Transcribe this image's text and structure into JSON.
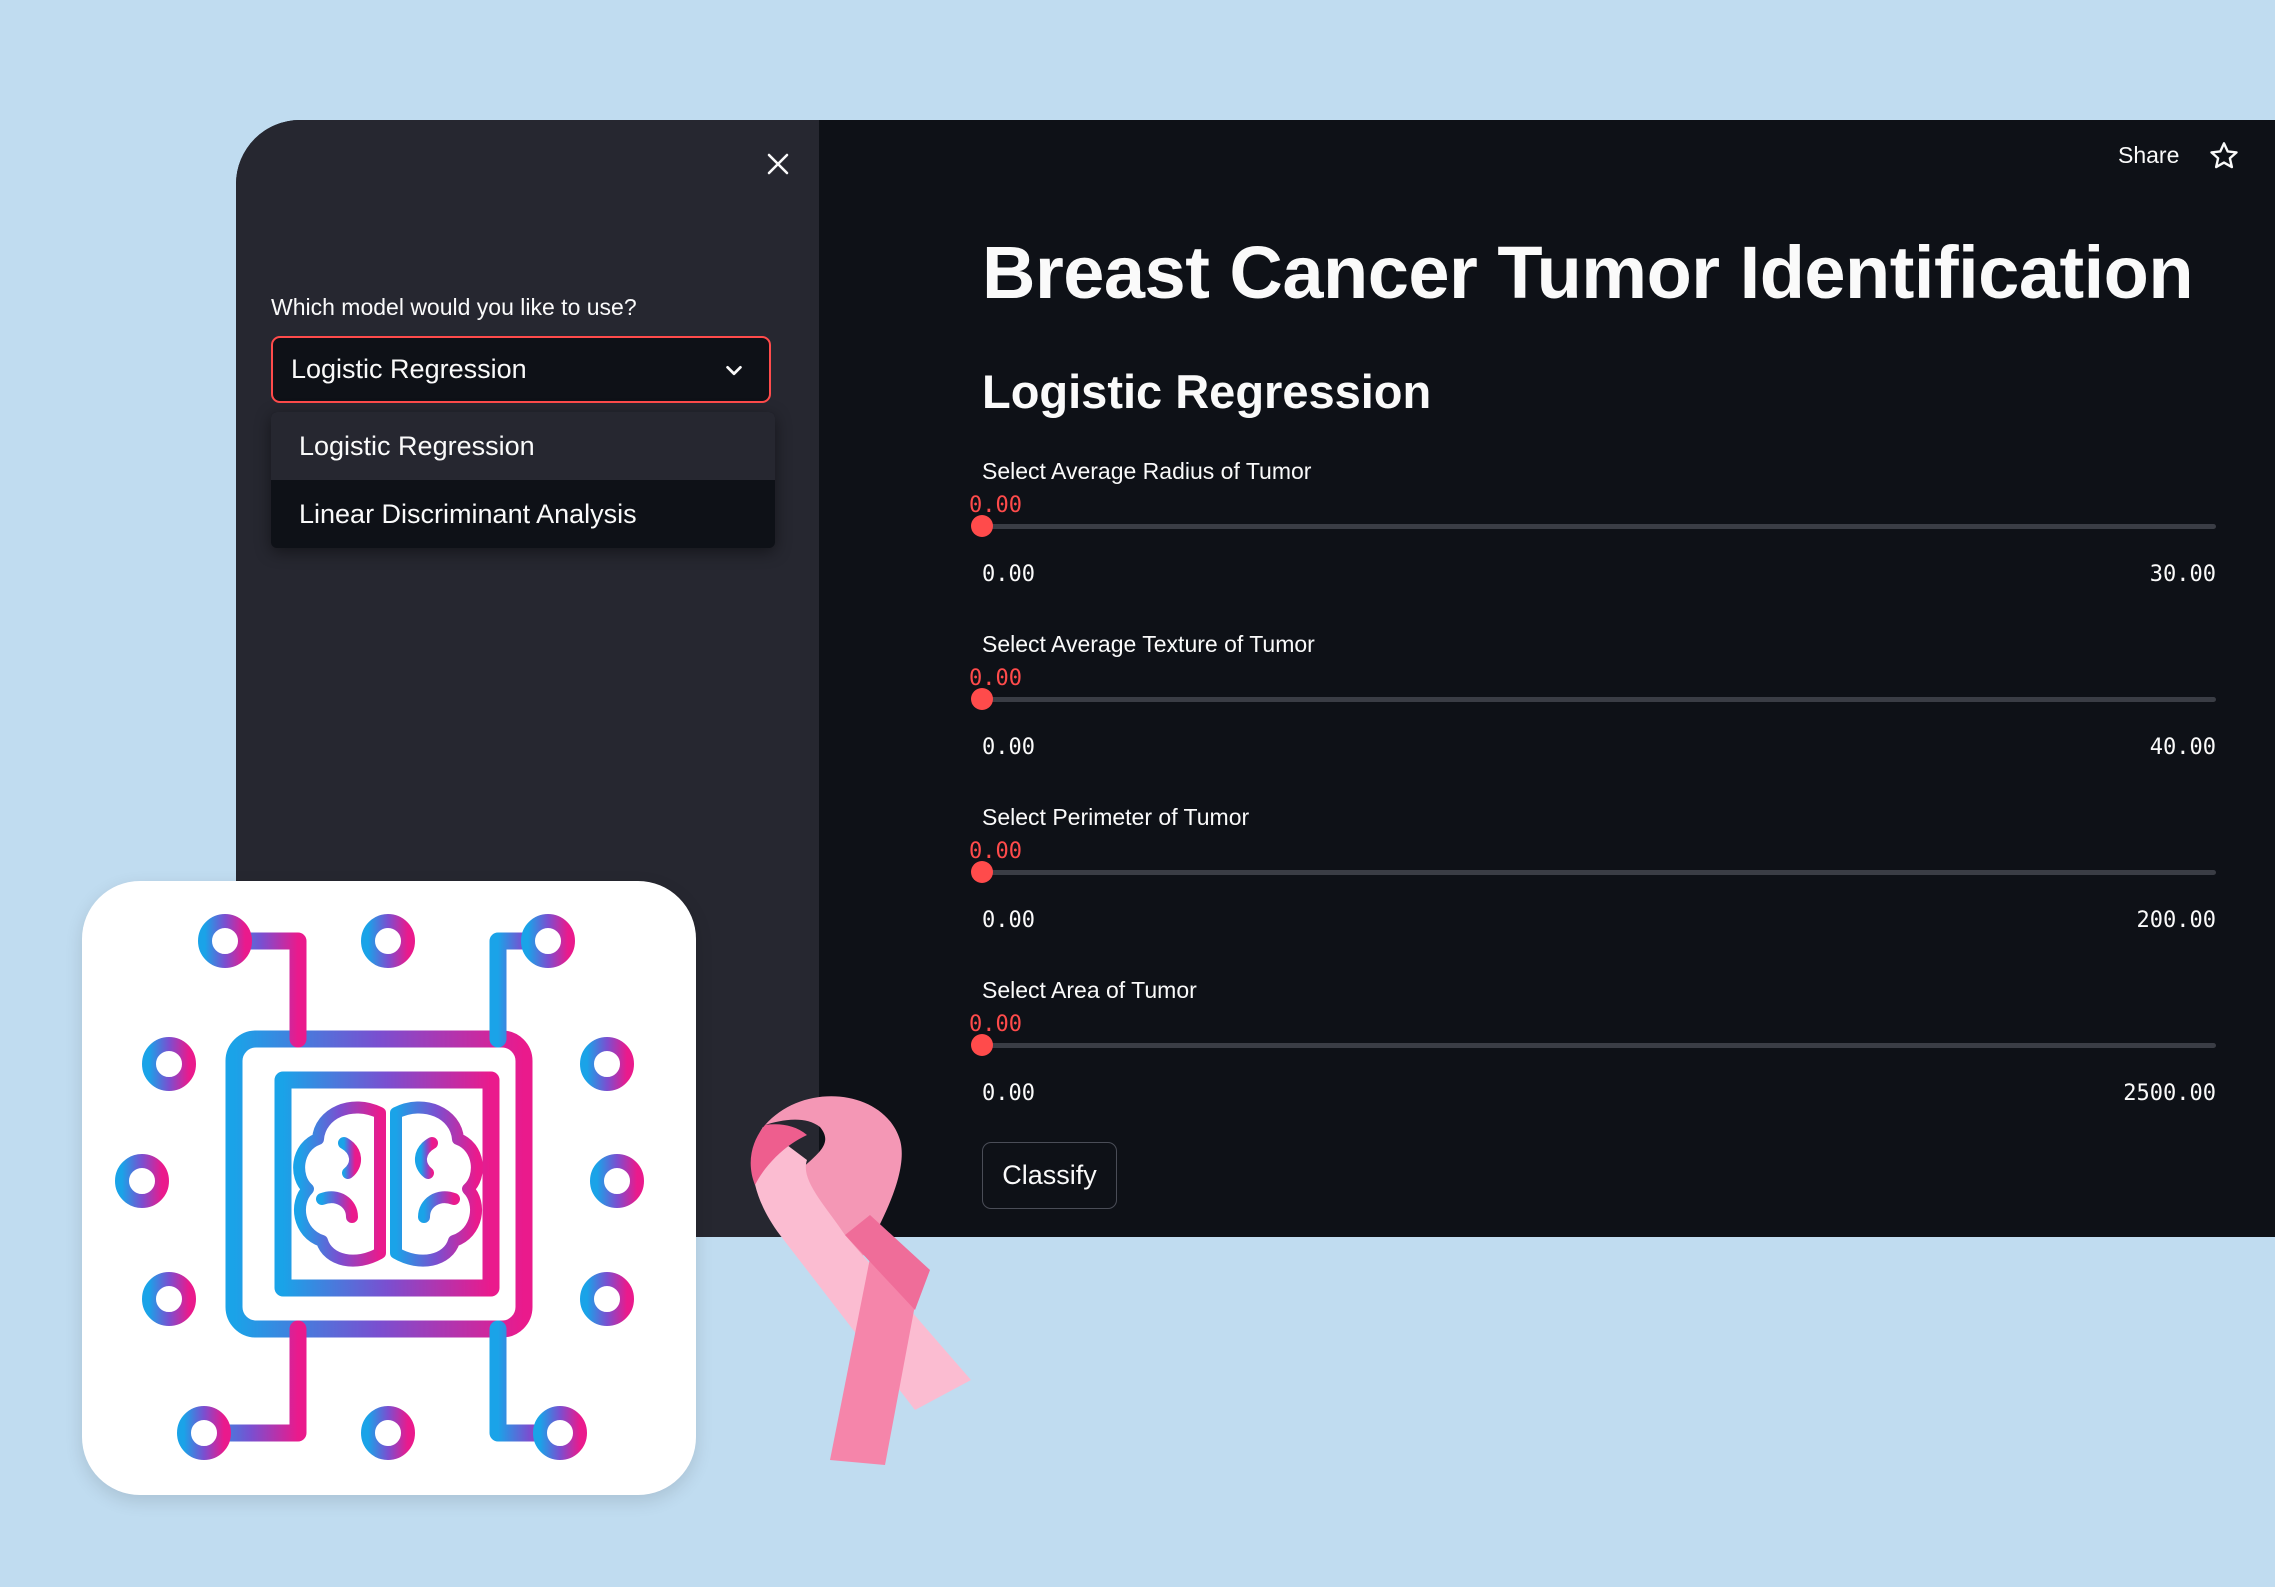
{
  "sidebar": {
    "model_label": "Which model would you like to use?",
    "selected_model": "Logistic Regression",
    "options": [
      "Logistic Regression",
      "Linear Discriminant Analysis"
    ]
  },
  "toolbar": {
    "share_label": "Share"
  },
  "main": {
    "title": "Breast Cancer Tumor Identification",
    "model_heading": "Logistic Regression",
    "sliders": [
      {
        "label": "Select Average Radius of Tumor",
        "value": "0.00",
        "min": "0.00",
        "max": "30.00",
        "fraction": 0.0
      },
      {
        "label": "Select Average Texture of Tumor",
        "value": "0.00",
        "min": "0.00",
        "max": "40.00",
        "fraction": 0.0
      },
      {
        "label": "Select Perimeter of Tumor",
        "value": "0.00",
        "min": "0.00",
        "max": "200.00",
        "fraction": 0.0
      },
      {
        "label": "Select Area of Tumor",
        "value": "0.00",
        "min": "0.00",
        "max": "2500.00",
        "fraction": 0.0
      }
    ],
    "classify_label": "Classify"
  },
  "colors": {
    "background": "#c0dcf0",
    "sidebar_bg": "#262730",
    "main_bg": "#0e1117",
    "accent": "#ff4b4b",
    "text": "#fafafa"
  },
  "icons": {
    "close": "close-icon",
    "chevron": "chevron-down-icon",
    "star": "star-icon",
    "logo": "ai-chip-brain-icon",
    "ribbon": "pink-ribbon-icon"
  }
}
